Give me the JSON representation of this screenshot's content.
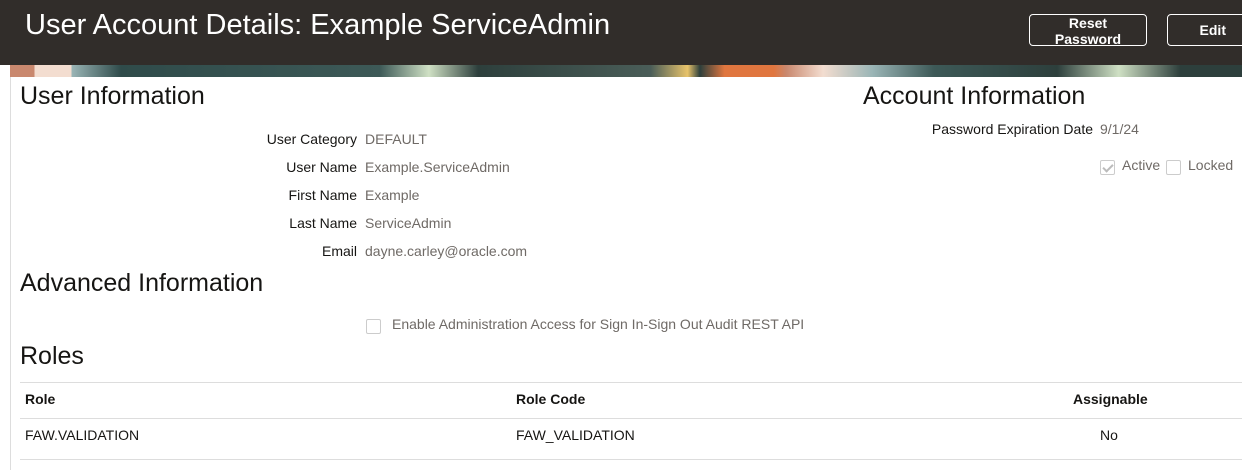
{
  "header": {
    "title": "User Account Details: Example ServiceAdmin",
    "reset_password": "Reset Password",
    "edit": "Edit"
  },
  "user_info": {
    "heading": "User Information",
    "fields": [
      {
        "label": "User Category",
        "value": "DEFAULT"
      },
      {
        "label": "User Name",
        "value": "Example.ServiceAdmin"
      },
      {
        "label": "First Name",
        "value": "Example"
      },
      {
        "label": "Last Name",
        "value": "ServiceAdmin"
      },
      {
        "label": "Email",
        "value": "dayne.carley@oracle.com"
      }
    ]
  },
  "account_info": {
    "heading": "Account Information",
    "password_expiration_label": "Password Expiration Date",
    "password_expiration_value": "9/1/24",
    "active_label": "Active",
    "active_checked": true,
    "locked_label": "Locked",
    "locked_checked": false
  },
  "advanced": {
    "heading": "Advanced Information",
    "audit_label": "Enable Administration Access for Sign In-Sign Out Audit REST API",
    "audit_checked": false
  },
  "roles": {
    "heading": "Roles",
    "columns": [
      "Role",
      "Role Code",
      "Assignable"
    ],
    "rows": [
      [
        "FAW.VALIDATION",
        "FAW_VALIDATION",
        "No"
      ]
    ]
  }
}
